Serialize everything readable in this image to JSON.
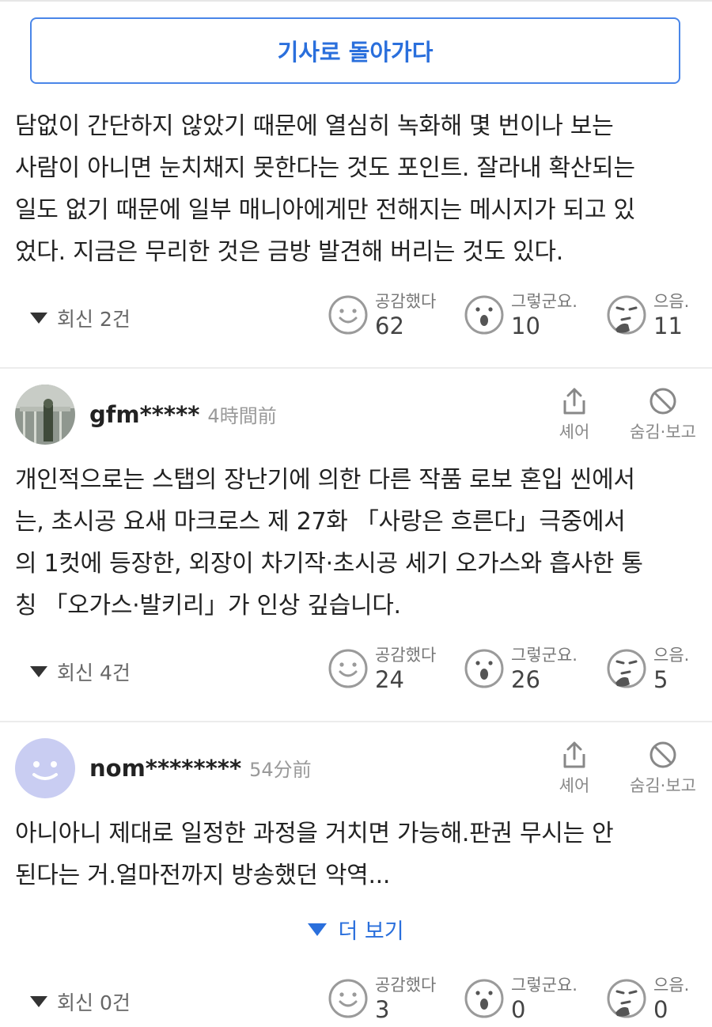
{
  "back_button": "기사로 돌아가다",
  "comment0": {
    "lines": [
      "담없이 간단하지 않았기 때문에 열심히 녹화해 몇 번이나 보는",
      "사람이 아니면 눈치채지 못한다는 것도 포인트. 잘라내 확산되는",
      "일도 없기 때문에 일부 매니아에게만 전해지는 메시지가 되고 있",
      "었다. 지금은 무리한 것은 금방 발견해 버리는 것도 있다."
    ],
    "replies": "회신 2건",
    "reactions": [
      {
        "label": "공감했다",
        "count": "62",
        "icon": "smile-icon"
      },
      {
        "label": "그렇군요.",
        "count": "10",
        "icon": "surprised-icon"
      },
      {
        "label": "으음.",
        "count": "11",
        "icon": "thinking-icon"
      }
    ]
  },
  "comment1": {
    "user": "gfm*****",
    "time": "4時間前",
    "lines": [
      "개인적으로는 스탭의 장난기에 의한 다른 작품 로보 혼입 씬에서",
      "는, 초시공 요새 마크로스 제 27화 「사랑은 흐른다」극중에서",
      "의 1컷에 등장한, 외장이 차기작·초시공 세기 오가스와 흡사한 통",
      "칭 「오가스·발키리」가 인상 깊습니다."
    ],
    "replies": "회신 4건",
    "reactions": [
      {
        "label": "공감했다",
        "count": "24",
        "icon": "smile-icon"
      },
      {
        "label": "그렇군요.",
        "count": "26",
        "icon": "surprised-icon"
      },
      {
        "label": "으음.",
        "count": "5",
        "icon": "thinking-icon"
      }
    ]
  },
  "comment2": {
    "user": "nom********",
    "time": "54分前",
    "lines": [
      "아니아니 제대로 일정한 과정을 거치면 가능해.판권 무시는 안",
      "된다는 거.얼마전까지 방송했던 악역..."
    ],
    "more": "더 보기",
    "replies": "회신 0건",
    "reactions": [
      {
        "label": "공감했다",
        "count": "3",
        "icon": "smile-icon"
      },
      {
        "label": "그렇군요.",
        "count": "0",
        "icon": "surprised-icon"
      },
      {
        "label": "으음.",
        "count": "0",
        "icon": "thinking-icon"
      }
    ]
  },
  "actions": {
    "share": "셰어",
    "hide": "숨김·보고"
  },
  "colors": {
    "accent": "#2a6fdc",
    "avatar_default": "#c9cdf2"
  }
}
